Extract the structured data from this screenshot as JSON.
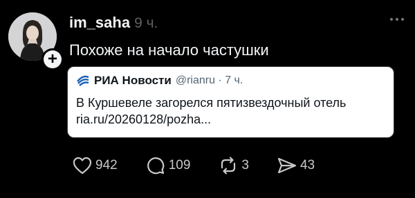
{
  "post": {
    "username": "im_saha",
    "timestamp": "9 ч.",
    "text": "Похоже на начало частушки"
  },
  "quote": {
    "name": "РИА Новости",
    "handle": "@rianru · 7 ч.",
    "body_line1": "В Куршевеле загорелся пятизвездочный отель",
    "body_line2": "ria.ru/20260128/pozha..."
  },
  "actions": {
    "likes": "942",
    "replies": "109",
    "reposts": "3",
    "shares": "43"
  },
  "icons": {
    "like": "heart-icon",
    "reply": "comment-icon",
    "repost": "repost-icon",
    "share": "send-icon",
    "more": "more-horizontal-icon",
    "follow": "plus-icon",
    "quote_logo": "ria-logo-icon"
  },
  "colors": {
    "background": "#000000",
    "text_primary": "#f3f5f7",
    "text_secondary": "#616161",
    "card_background": "#ffffff",
    "ria_blue": "#1a5fb4"
  }
}
